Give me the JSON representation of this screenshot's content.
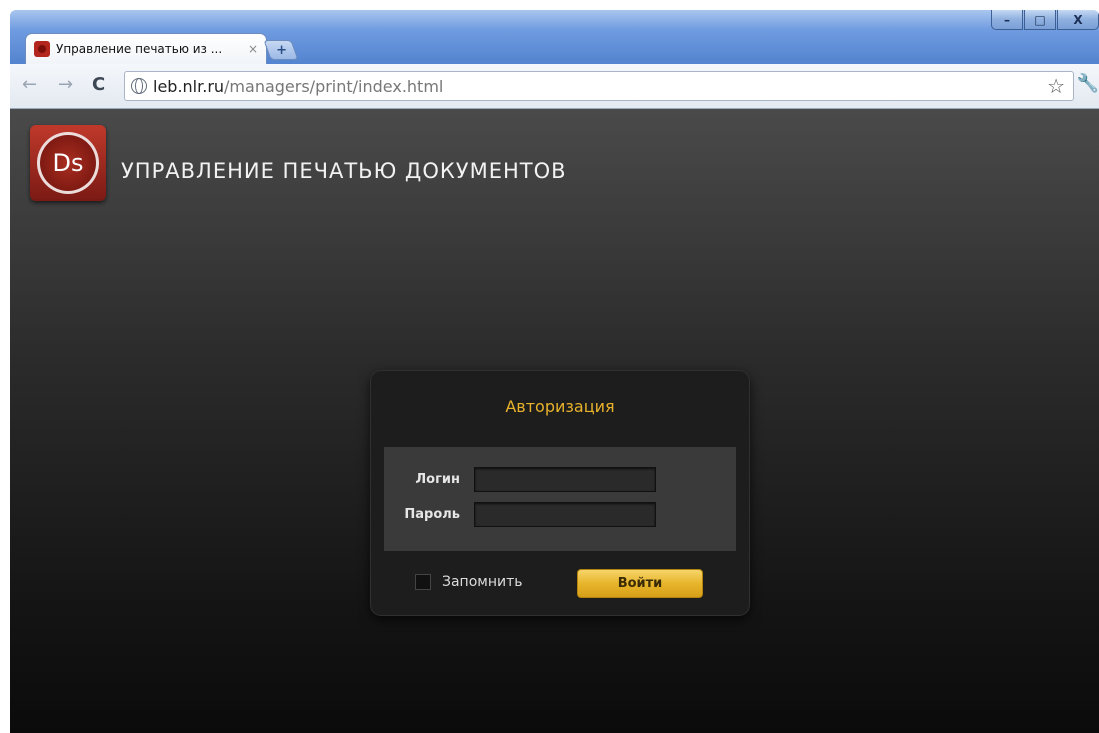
{
  "browser": {
    "tab_title": "Управление печатью из ...",
    "tab_close": "×",
    "new_tab": "+",
    "url_domain": "leb.nlr.ru",
    "url_path": "/managers/print/index.html",
    "window_controls": {
      "minimize": "–",
      "maximize": "□",
      "close": "X"
    },
    "icons": {
      "back": "←",
      "forward": "→",
      "reload": "C",
      "bookmark": "☆",
      "wrench": "🔧"
    }
  },
  "app": {
    "logo_text": "Ds",
    "title": "УПРАВЛЕНИЕ ПЕЧАТЬЮ ДОКУМЕНТОВ"
  },
  "login": {
    "heading": "Авторизация",
    "login_label": "Логин",
    "login_value": "",
    "password_label": "Пароль",
    "password_value": "",
    "remember_label": "Запомнить",
    "remember_checked": false,
    "submit_label": "Войти"
  },
  "colors": {
    "accent": "#e8b22b",
    "logo_red": "#b3261e"
  }
}
